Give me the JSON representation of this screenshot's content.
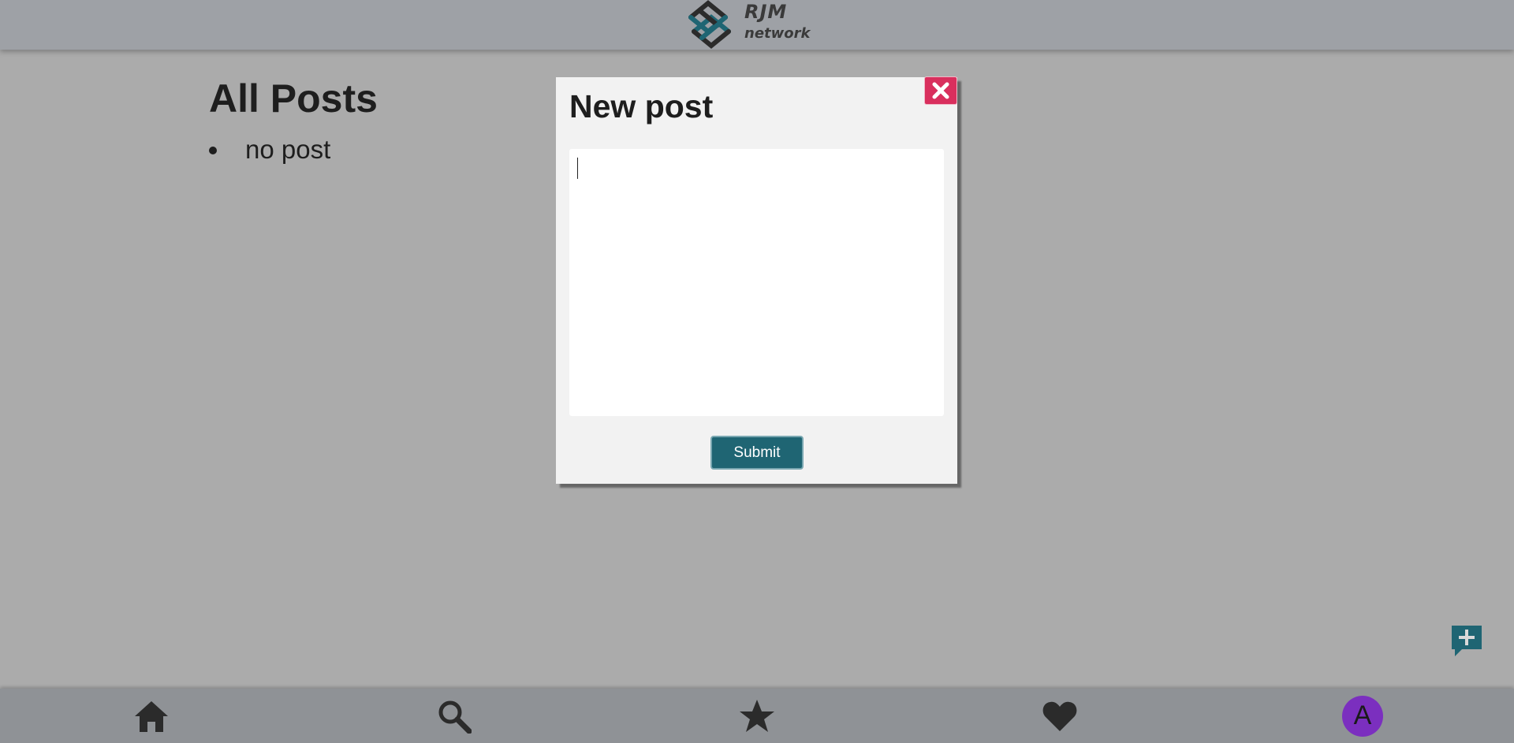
{
  "header": {
    "logo_text_top": "RJM",
    "logo_text_bottom": "network"
  },
  "main": {
    "title": "All Posts",
    "posts": [
      "no post"
    ]
  },
  "modal": {
    "title": "New post",
    "textarea_value": "",
    "submit_label": "Submit",
    "close_icon": "close-icon"
  },
  "fab": {
    "icon": "add-comment-icon"
  },
  "bottom_nav": {
    "items": [
      {
        "name": "home",
        "icon": "home-icon"
      },
      {
        "name": "search",
        "icon": "search-icon"
      },
      {
        "name": "favorites",
        "icon": "star-icon"
      },
      {
        "name": "liked",
        "icon": "heart-icon"
      },
      {
        "name": "profile",
        "avatar_letter": "A"
      }
    ]
  },
  "colors": {
    "accent": "#1f6573",
    "close": "#d92f5d",
    "avatar": "#7b2fbf",
    "backdrop": "#ababab"
  }
}
